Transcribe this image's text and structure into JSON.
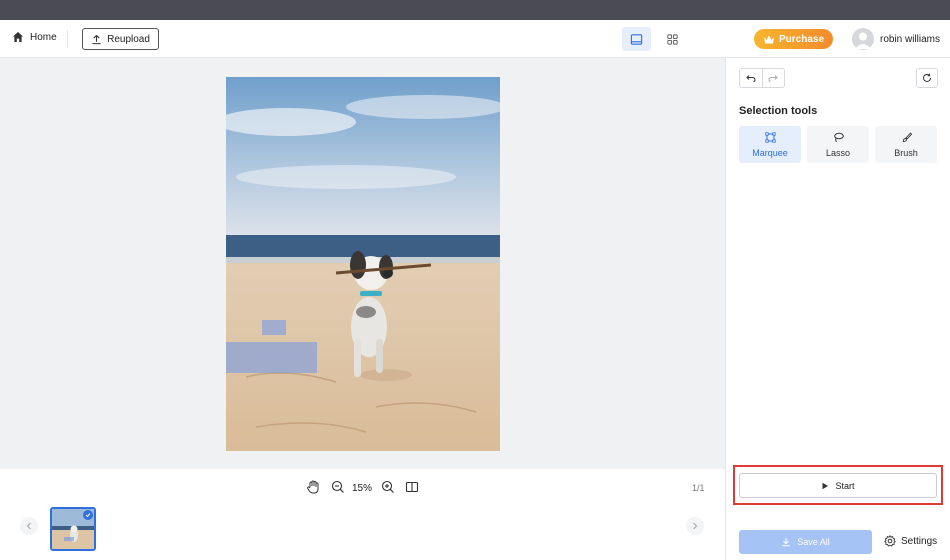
{
  "header": {
    "home_label": "Home",
    "reupload_label": "Reupload",
    "purchase_label": "Purchase",
    "user_name": "robin williams"
  },
  "toolbar": {
    "zoom_level": "15%",
    "page_count": "1/1"
  },
  "panel": {
    "selection_title": "Selection tools",
    "tools": [
      {
        "label": "Marquee",
        "icon": "marquee-icon",
        "active": true
      },
      {
        "label": "Lasso",
        "icon": "lasso-icon",
        "active": false
      },
      {
        "label": "Brush",
        "icon": "brush-icon",
        "active": false
      }
    ],
    "start_label": "Start",
    "save_all_label": "Save All",
    "settings_label": "Settings"
  },
  "colors": {
    "accent": "#2f6fde",
    "highlight": "#e03a37",
    "purchase_start": "#f6b62e",
    "purchase_end": "#f28b2b"
  }
}
